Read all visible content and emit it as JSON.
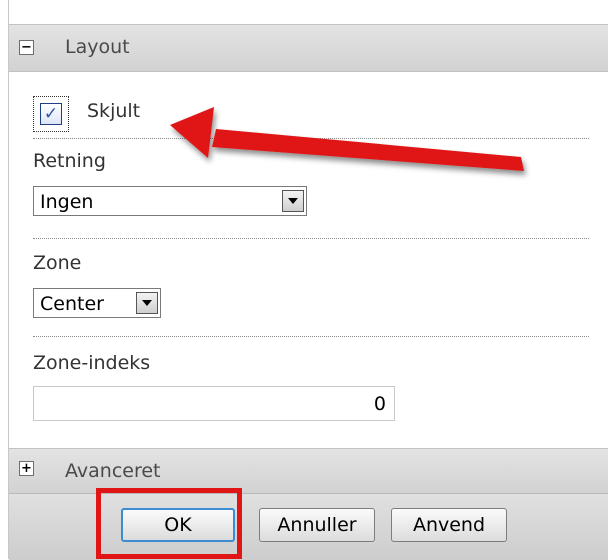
{
  "sections": {
    "layout": {
      "toggle": "−",
      "title": "Layout"
    },
    "advanced": {
      "toggle": "+",
      "title": "Avanceret"
    }
  },
  "fields": {
    "hidden": {
      "label": "Skjult",
      "checked": true,
      "check_glyph": "✓"
    },
    "direction": {
      "label": "Retning",
      "value": "Ingen"
    },
    "zone": {
      "label": "Zone",
      "value": "Center"
    },
    "zone_index": {
      "label": "Zone-indeks",
      "value": "0"
    }
  },
  "buttons": {
    "ok": "OK",
    "cancel": "Annuller",
    "apply": "Anvend"
  },
  "annotations": {
    "arrow_color": "#e01616",
    "highlight_color": "#e01616"
  }
}
